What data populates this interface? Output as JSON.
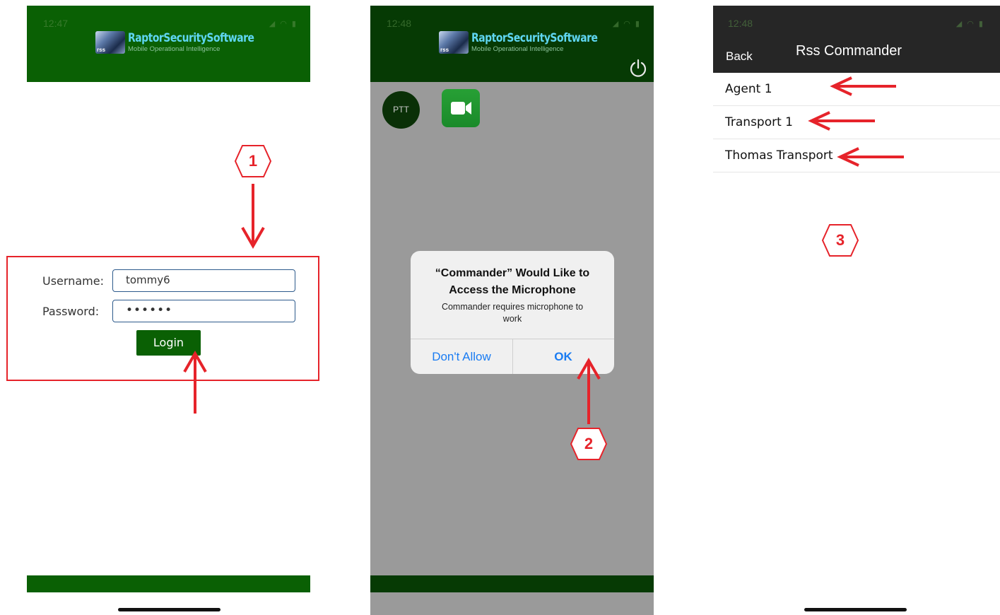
{
  "login_screen": {
    "status_time": "12:47",
    "status_icons": "◢ ◠ ▮",
    "brand_name": "RaptorSecuritySoftware",
    "brand_tagline": "Mobile Operational Intelligence",
    "username_label": "Username:",
    "username_value": "tommy6",
    "password_label": "Password:",
    "password_value": "••••••",
    "login_label": "Login"
  },
  "permission_screen": {
    "status_time": "12:48",
    "status_icons": "◢ ◠ ▮",
    "brand_name": "RaptorSecuritySoftware",
    "brand_tagline": "Mobile Operational Intelligence",
    "ptt_label": "PTT",
    "alert": {
      "title": "“Commander” Would Like to Access the Microphone",
      "message": "Commander requires microphone to work",
      "deny_label": "Don't Allow",
      "ok_label": "OK"
    }
  },
  "list_screen": {
    "status_time": "12:48",
    "status_icons": "◢ ◠ ▮",
    "back_label": "Back",
    "title": "Rss Commander",
    "items": [
      "Agent 1",
      "Transport 1",
      "Thomas Transport"
    ]
  },
  "steps": [
    "1",
    "2",
    "3"
  ],
  "colors": {
    "header_green": "#0a6004",
    "dark_green": "#063a04",
    "annotation_red": "#e6232a",
    "ios_blue": "#1a7cf2"
  }
}
